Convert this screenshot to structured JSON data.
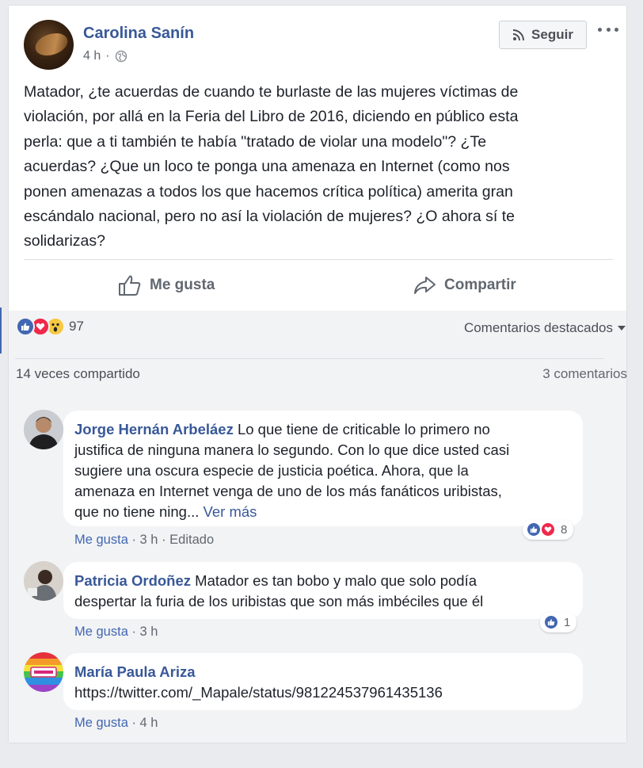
{
  "post": {
    "author": "Carolina Sanín",
    "time": "4 h",
    "privacy_icon": "globe-icon",
    "follow_label": "Seguir",
    "text": "Matador, ¿te acuerdas de cuando te burlaste de las mujeres víctimas de\nviolación, por allá en la Feria del Libro de 2016, diciendo en público esta\nperla: que a ti también te había \"tratado de violar una modelo\"? ¿Te\nacuerdas? ¿Que un loco te ponga una amenaza en Internet (como nos\nponen amenazas a todos los que hacemos crítica política) amerita gran\nescándalo nacional, pero no así la violación de mujeres? ¿O ahora sí te\nsolidarizas?",
    "like_label": "Me gusta",
    "share_label": "Compartir"
  },
  "stats": {
    "reaction_count": "97",
    "reaction_icons": [
      "like",
      "love",
      "wow"
    ],
    "featured_label": "Comentarios destacados",
    "shares_label": "14 veces compartido",
    "comments_label": "3 comentarios"
  },
  "comments": [
    {
      "name": "Jorge Hernán Arbeláez",
      "text_line1": " Lo que tiene de criticable lo primero no",
      "text_rest": "justifica de ninguna manera lo segundo. Con lo que dice usted casi\nsugiere una oscura especie de justicia poética. Ahora, que la\namenaza en Internet venga de uno de los más fanáticos uribistas,\nque no tiene ning... ",
      "see_more": "Ver más",
      "like": "Me gusta",
      "time": "3 h",
      "edited": "Editado",
      "reaction_count": "8"
    },
    {
      "name": "Patricia Ordoñez",
      "text_line1": " Matador es tan bobo y malo que solo podía",
      "text_rest": "despertar la furia de los uribistas que son más imbéciles que él",
      "like": "Me gusta",
      "time": "3 h",
      "reaction_count": "1"
    },
    {
      "name": "María Paula Ariza",
      "link": "https://twitter.com/_Mapale/status/981224537961435136",
      "like": "Me gusta",
      "time": "4 h"
    }
  ],
  "colors": {
    "link_blue": "#385898",
    "fb_blue": "#4267b2",
    "love_red": "#f0284a",
    "wow_yellow": "#f7c941"
  }
}
